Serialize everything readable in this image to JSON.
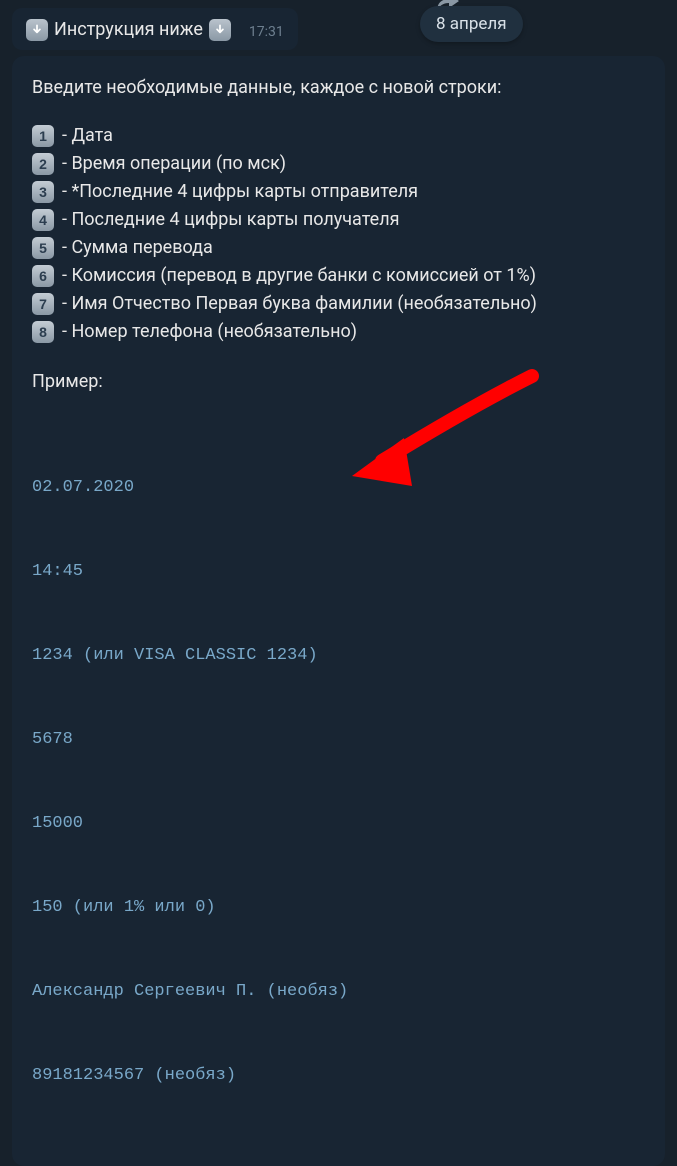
{
  "top_message": {
    "text": "Инструкция ниже",
    "time": "17:31"
  },
  "date_badge": "8 апреля",
  "main": {
    "intro": "Введите необходимые данные, каждое с новой строки:",
    "items": [
      {
        "n": "1",
        "label": " - Дата"
      },
      {
        "n": "2",
        "label": " - Время операции (по мск)"
      },
      {
        "n": "3",
        "label": " - *Последние 4 цифры карты отправителя"
      },
      {
        "n": "4",
        "label": " - Последние 4 цифры карты получателя"
      },
      {
        "n": "5",
        "label": " - Сумма перевода"
      },
      {
        "n": "6",
        "label": " - Комиссия (перевод в другие банки с комиссией от 1%)"
      },
      {
        "n": "7",
        "label": " - Имя Отчество Первая буква фамилии (необязательно)"
      },
      {
        "n": "8",
        "label": " - Номер телефона (необязательно)"
      }
    ],
    "example_label": "Пример:",
    "example_lines": [
      "02.07.2020",
      "14:45",
      "1234 (или VISA CLASSIC 1234)",
      "5678",
      "15000",
      "150 (или 1% или 0)",
      "Александр Сергеевич П. (необяз)",
      "89181234567 (необяз)"
    ]
  }
}
